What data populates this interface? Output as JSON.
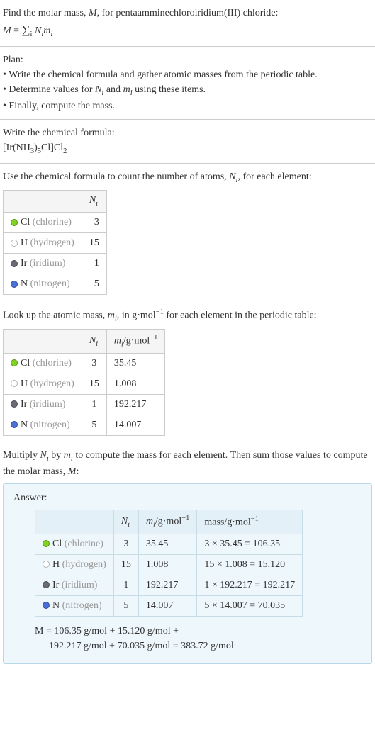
{
  "intro": {
    "line1a": "Find the molar mass, ",
    "line1b": ", for pentaamminechloroiridium(III) chloride:",
    "M": "M",
    "eq": " = ",
    "sum": "∑",
    "sumsub": "i",
    "Ni": "N",
    "isub": "i",
    "mi": "m"
  },
  "plan": {
    "title": "Plan:",
    "b1": "• Write the chemical formula and gather atomic masses from the periodic table.",
    "b2a": "• Determine values for ",
    "b2b": " and ",
    "b2c": " using these items.",
    "b3": "• Finally, compute the mass."
  },
  "chem": {
    "title": "Write the chemical formula:",
    "p1": "[Ir(NH",
    "s1": "3",
    "p2": ")",
    "s2": "5",
    "p3": "Cl]Cl",
    "s3": "2"
  },
  "count": {
    "line_a": "Use the chemical formula to count the number of atoms, ",
    "line_b": ", for each element:",
    "hdr_ni": "N",
    "hdr_ni_sub": "i"
  },
  "elements": [
    {
      "sym": "Cl",
      "name": "(chlorine)",
      "color": "#7fd321",
      "n": "3",
      "m": "35.45",
      "mass": "3 × 35.45 = 106.35"
    },
    {
      "sym": "H",
      "name": "(hydrogen)",
      "color": "#ffffff",
      "n": "15",
      "m": "1.008",
      "mass": "15 × 1.008 = 15.120"
    },
    {
      "sym": "Ir",
      "name": "(iridium)",
      "color": "#6b6b78",
      "n": "1",
      "m": "192.217",
      "mass": "1 × 192.217 = 192.217"
    },
    {
      "sym": "N",
      "name": "(nitrogen)",
      "color": "#4a6fd8",
      "n": "5",
      "m": "14.007",
      "mass": "5 × 14.007 = 70.035"
    }
  ],
  "lookup": {
    "line_a": "Look up the atomic mass, ",
    "line_b": ", in g·mol",
    "line_c": " for each element in the periodic table:",
    "neg1": "−1",
    "hdr_mi": "m",
    "hdr_mi_sub": "i",
    "hdr_unit": "/g·mol"
  },
  "mult": {
    "line_a": "Multiply ",
    "line_b": " by ",
    "line_c": " to compute the mass for each element. Then sum those values to compute the molar mass, ",
    "line_d": ":"
  },
  "answer": {
    "label": "Answer:",
    "hdr_mass": "mass/g·mol",
    "final1": "M = 106.35 g/mol + 15.120 g/mol + ",
    "final2": "192.217 g/mol + 70.035 g/mol = 383.72 g/mol"
  }
}
